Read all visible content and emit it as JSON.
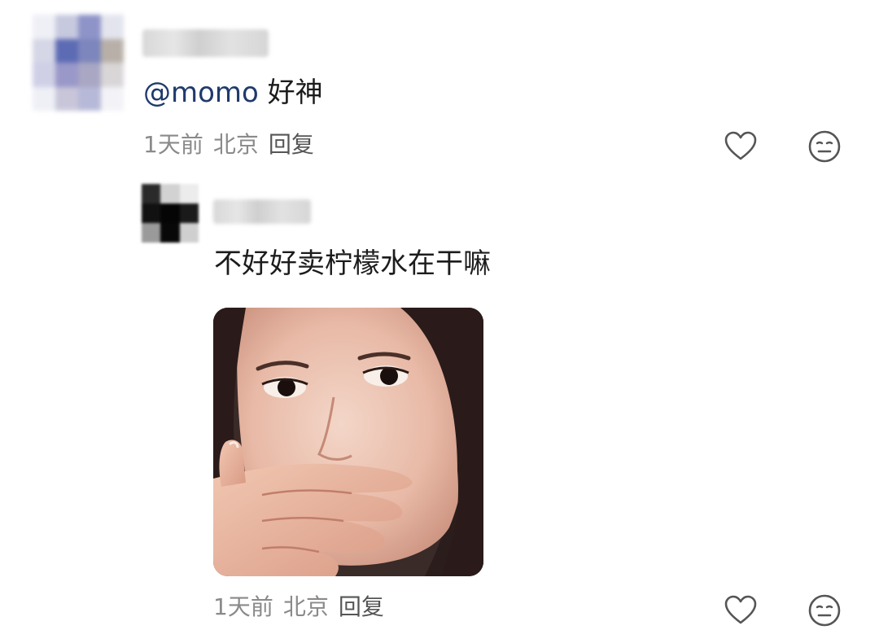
{
  "main_comment": {
    "mention": "@momo",
    "text": " 好神",
    "time": "1天前",
    "location": "北京",
    "reply_label": "回复",
    "avatar_colors": [
      "#eef0f6",
      "#c7c9df",
      "#8e94c8",
      "#e3e4ee",
      "#d5d6e6",
      "#5d6bb4",
      "#7d86bd",
      "#b8b0a8",
      "#cfd0e6",
      "#9a98c9",
      "#a9a7c4",
      "#d9d6d8",
      "#eef0f6",
      "#c9c6da",
      "#b7b9d8",
      "#f3f3f7"
    ]
  },
  "reply_comment": {
    "text": "不好好卖柠檬水在干嘛",
    "time": "1天前",
    "location": "北京",
    "reply_label": "回复",
    "avatar_colors": [
      "#2a2a2a",
      "#d2d2d2",
      "#ececec",
      "#111111",
      "#050505",
      "#1a1a1a",
      "#9a9a9a",
      "#080808",
      "#cfcfcf"
    ],
    "image": "reaction-photo-woman-covering-mouth"
  },
  "icons": {
    "like": "heart-icon",
    "emoji": "neutral-face-icon"
  }
}
